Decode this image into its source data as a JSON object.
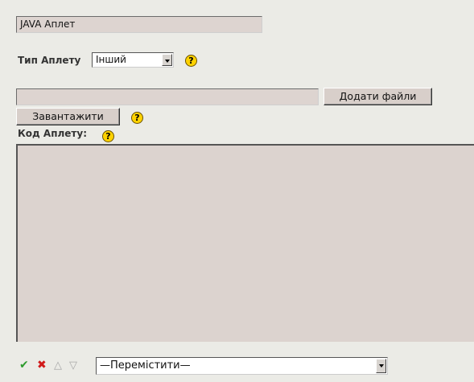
{
  "title_field": {
    "value": "JAVA Аплет"
  },
  "applet_type": {
    "label": "Тип Аплету",
    "selected": "Інший"
  },
  "file_input": {
    "value": ""
  },
  "add_files_button": {
    "label": "Додати файли"
  },
  "upload_button": {
    "label": "Завантажити"
  },
  "applet_code": {
    "label": "Код Аплету:",
    "value": ""
  },
  "help_icon_glyph": "?",
  "toolbar": {
    "accept_icon": "✔",
    "delete_icon": "✖",
    "move_up_icon": "△",
    "move_down_icon": "▽",
    "move_select": {
      "selected": "—Перемістити—"
    }
  },
  "colors": {
    "background": "#ebebe6",
    "field": "#ddd4d0",
    "help_icon": "#ffd200",
    "accept": "#2e9b2e",
    "delete": "#d11a1a"
  }
}
